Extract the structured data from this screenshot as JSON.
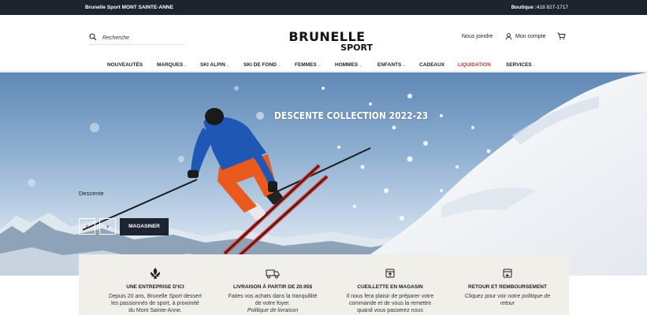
{
  "topbar": {
    "store_name": "Brunelle Sport MONT SAINTE-ANNE",
    "boutique_label": "Boutique :",
    "phone": "418 827-1717"
  },
  "header": {
    "search_placeholder": "Recherche",
    "logo_line1": "BRUNELLE",
    "logo_line2": "SPORT",
    "contact_label": "Nous joindre",
    "account_label": "Mon compte"
  },
  "nav": [
    {
      "label": "NOUVEAUTÉS",
      "chevron": false
    },
    {
      "label": "MARQUES",
      "chevron": true
    },
    {
      "label": "SKI ALPIN",
      "chevron": true
    },
    {
      "label": "SKI DE FOND",
      "chevron": true
    },
    {
      "label": "FEMMES",
      "chevron": true
    },
    {
      "label": "HOMMES",
      "chevron": true
    },
    {
      "label": "ENFANTS",
      "chevron": true
    },
    {
      "label": "CADEAUX",
      "chevron": false
    },
    {
      "label": "LIQUIDATION",
      "chevron": false
    },
    {
      "label": "SERVICES",
      "chevron": true
    }
  ],
  "hero": {
    "title": "DESCENTE COLLECTION 2022-23",
    "subtitle": "Descente",
    "shop_label": "MAGASINER",
    "prev_symbol": "‹",
    "next_symbol": "›"
  },
  "features": [
    {
      "icon": "fleur-de-lis-icon",
      "title": "UNE ENTREPRISE D'ICI",
      "text": "Depuis 20 ans, Brunelle Sport dessert les passionnés de sport, à proximité du Mont Sainte-Anne."
    },
    {
      "icon": "truck-icon",
      "title": "LIVRAISON À PARTIR DE 20.95$",
      "text": "Faites vos achats dans la tranquillité de votre foyer.",
      "link": "Politique de livraison"
    },
    {
      "icon": "store-pickup-icon",
      "title": "CUEILLETTE EN MAGASIN",
      "text": "Il nous fera plaisir de préparer votre commande et de vous la remettre quand vous passerez nous"
    },
    {
      "icon": "return-box-icon",
      "title": "RETOUR ET REMBOURSEMENT",
      "text_prefix": "Cliquez pour voir notre ",
      "text_italic": "politique de retour"
    }
  ],
  "colors": {
    "topbar_bg": "#1d2430",
    "accent_red": "#c0392b",
    "features_bg": "#f0efea",
    "button_dark": "#1d2430"
  }
}
